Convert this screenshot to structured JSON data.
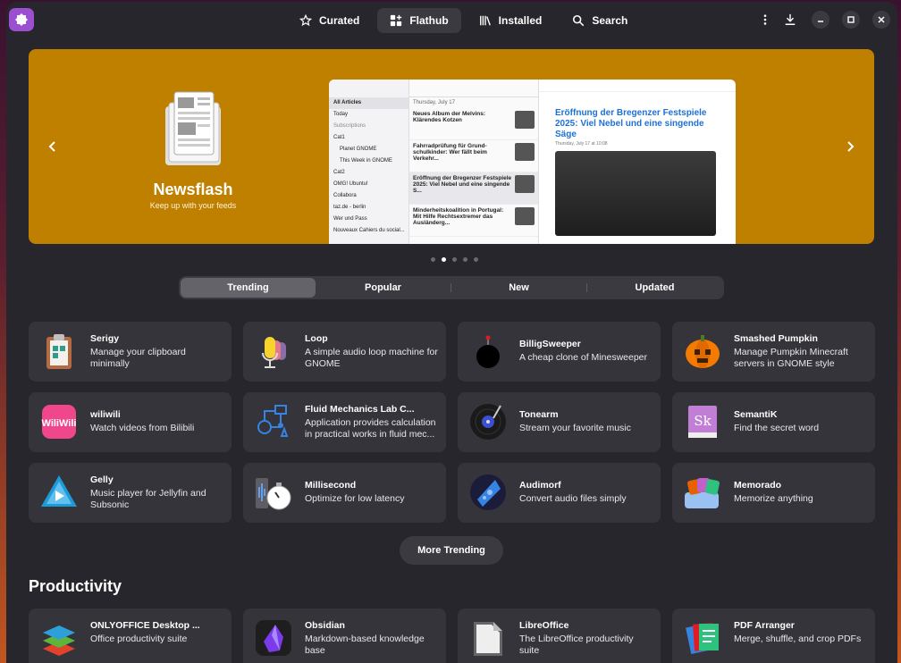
{
  "header": {
    "tabs": [
      {
        "label": "Curated",
        "icon": "star-icon",
        "active": false
      },
      {
        "label": "Flathub",
        "icon": "puzzle-icon",
        "active": true
      },
      {
        "label": "Installed",
        "icon": "library-icon",
        "active": false
      },
      {
        "label": "Search",
        "icon": "search-icon",
        "active": false
      }
    ]
  },
  "featured": {
    "name": "Newsflash",
    "tagline": "Keep up with your feeds",
    "accent": "#bf8000",
    "screenshot": {
      "sidebar": [
        "All Articles",
        "Today",
        "Subscriptions",
        "Cat1",
        "Planet GNOME",
        "This Week in GNOME",
        "Cat2",
        "OMG! Ubuntu!",
        "Collabora",
        "taz.de - berlin",
        "Wer und Pass",
        "Nouveaux Cahiers du social..."
      ],
      "date_header": "Thursday, July 17",
      "articles": [
        {
          "title": "Neues Album der Melvins: Klärendes Kotzen"
        },
        {
          "title": "Fahrradprüfung für Grund-schulkinder: Wer fällt beim Verkehr..."
        },
        {
          "title": "Eröffnung der Bregenzer Festspiele 2025: Viel Nebel und eine singende S..."
        },
        {
          "title": "Minderheitskoalition in Portugal: Mit Hilfe Rechtsextremer das Ausländerg..."
        }
      ],
      "article_title": "Eröffnung der Bregenzer Festspiele 2025: Viel Nebel und eine singende Säge",
      "article_date": "Thursday, July 17 at 10:08"
    },
    "dot_count": 5,
    "active_dot": 1
  },
  "toggle": [
    "Trending",
    "Popular",
    "New",
    "Updated"
  ],
  "apps": [
    {
      "name": "Serigy",
      "desc": "Manage your clipboard minimally",
      "icon": "clipboard-icon"
    },
    {
      "name": "Loop",
      "desc": "A simple audio loop machine for GNOME",
      "icon": "microphone-icon"
    },
    {
      "name": "BilligSweeper",
      "desc": "A cheap clone of Minesweeper",
      "icon": "bomb-icon"
    },
    {
      "name": "Smashed Pumpkin",
      "desc": "Manage Pumpkin Minecraft servers in GNOME style",
      "icon": "pumpkin-icon"
    },
    {
      "name": "wiliwili",
      "desc": "Watch videos from Bilibili",
      "icon": "wiliwili-icon"
    },
    {
      "name": "Fluid Mechanics Lab C...",
      "desc": "Application provides calculation in practical works in fluid mec...",
      "icon": "flowchart-icon"
    },
    {
      "name": "Tonearm",
      "desc": "Stream your favorite music",
      "icon": "vinyl-icon"
    },
    {
      "name": "SemantiK",
      "desc": "Find the secret word",
      "icon": "sk-book-icon"
    },
    {
      "name": "Gelly",
      "desc": "Music player for Jellyfin and Subsonic",
      "icon": "play-triangle-icon"
    },
    {
      "name": "Millisecond",
      "desc": "Optimize for low latency",
      "icon": "stopwatch-icon"
    },
    {
      "name": "Audimorf",
      "desc": "Convert audio files simply",
      "icon": "audio-morph-icon"
    },
    {
      "name": "Memorado",
      "desc": "Memorize anything",
      "icon": "memory-cards-icon"
    }
  ],
  "more_button": "More Trending",
  "section": "Productivity",
  "productivity": [
    {
      "name": "ONLYOFFICE Desktop ...",
      "desc": "Office productivity suite",
      "icon": "onlyoffice-icon"
    },
    {
      "name": "Obsidian",
      "desc": "Markdown-based knowledge base",
      "icon": "obsidian-icon"
    },
    {
      "name": "LibreOffice",
      "desc": "The LibreOffice productivity suite",
      "icon": "libreoffice-icon"
    },
    {
      "name": "PDF Arranger",
      "desc": "Merge, shuffle, and crop PDFs",
      "icon": "pdf-arranger-icon"
    }
  ]
}
